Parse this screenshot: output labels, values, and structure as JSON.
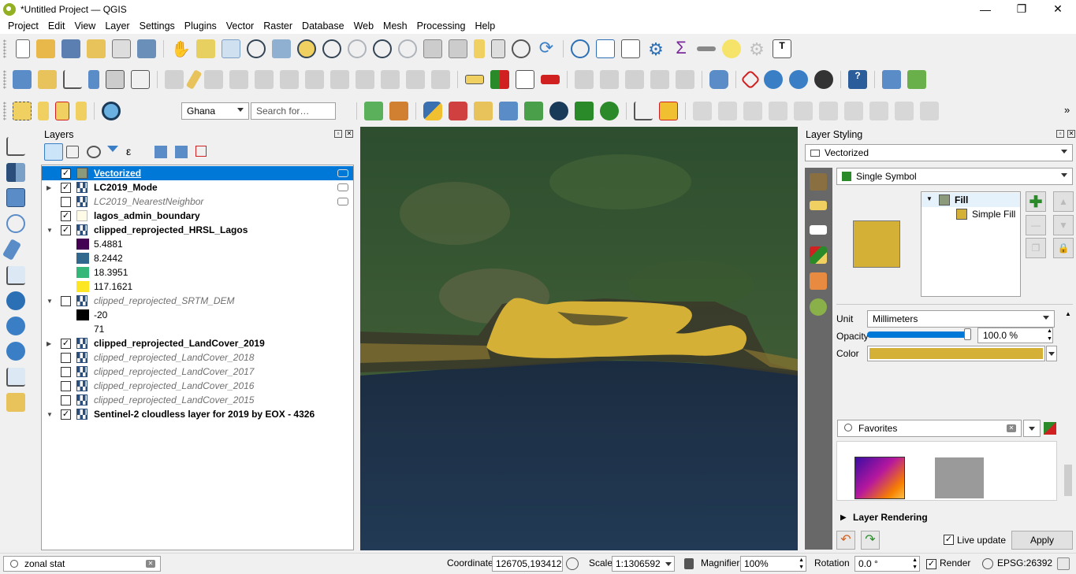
{
  "window": {
    "title": "*Untitled Project — QGIS",
    "controls": [
      "minimize-icon",
      "restore-icon",
      "close-icon"
    ]
  },
  "menu": [
    "Project",
    "Edit",
    "View",
    "Layer",
    "Settings",
    "Plugins",
    "Vector",
    "Raster",
    "Database",
    "Web",
    "Mesh",
    "Processing",
    "Help"
  ],
  "toolbar3": {
    "locator_value": "Ghana",
    "search_placeholder": "Search for…"
  },
  "layers_panel": {
    "title": "Layers",
    "items": [
      {
        "label": "Vectorized",
        "checked": true,
        "selected": true,
        "style": "bold-underline"
      },
      {
        "label": "LC2019_Mode",
        "checked": true,
        "style": "bold"
      },
      {
        "label": "LC2019_NearestNeighbor",
        "checked": false,
        "style": "italic"
      },
      {
        "label": "lagos_admin_boundary",
        "checked": true,
        "style": "bold"
      },
      {
        "label": "clipped_reprojected_HRSL_Lagos",
        "checked": true,
        "style": "bold"
      },
      {
        "label": "5.4881",
        "color": "#440154"
      },
      {
        "label": "8.2442",
        "color": "#31688e"
      },
      {
        "label": "18.3951",
        "color": "#35b779"
      },
      {
        "label": "117.1621",
        "color": "#fde725"
      },
      {
        "label": "clipped_reprojected_SRTM_DEM",
        "checked": false,
        "style": "italic"
      },
      {
        "label": "-20",
        "color": "#000000"
      },
      {
        "label": "71",
        "color": "#ffffff"
      },
      {
        "label": "clipped_reprojected_LandCover_2019",
        "checked": true,
        "style": "bold"
      },
      {
        "label": "clipped_reprojected_LandCover_2018",
        "checked": false,
        "style": "italic"
      },
      {
        "label": "clipped_reprojected_LandCover_2017",
        "checked": false,
        "style": "italic"
      },
      {
        "label": "clipped_reprojected_LandCover_2016",
        "checked": false,
        "style": "italic"
      },
      {
        "label": "clipped_reprojected_LandCover_2015",
        "checked": false,
        "style": "italic"
      },
      {
        "label": "Sentinel-2 cloudless layer for 2019 by EOX - 4326",
        "checked": true,
        "style": "bold"
      }
    ]
  },
  "styling_panel": {
    "title": "Layer Styling",
    "layer": "Vectorized",
    "renderer": "Single Symbol",
    "symbol_tree": {
      "root": "Fill",
      "child": "Simple Fill"
    },
    "unit_label": "Unit",
    "unit_value": "Millimeters",
    "opacity_label": "Opacity",
    "opacity_value": "100.0 %",
    "opacity_fraction": 1.0,
    "color_label": "Color",
    "fill_color": "#d4b037",
    "favorites_value": "Favorites",
    "layer_rendering": "Layer Rendering",
    "live_update": "Live update",
    "apply": "Apply"
  },
  "statusbar": {
    "search_value": "zonal stat",
    "coordinate_label": "Coordinate",
    "coordinate_value": "126705,193412",
    "scale_label": "Scale",
    "scale_value": "1:1306592",
    "magnifier_label": "Magnifier",
    "magnifier_value": "100%",
    "rotation_label": "Rotation",
    "rotation_value": "0.0 °",
    "render_label": "Render",
    "crs": "EPSG:26392"
  },
  "colors": {
    "selection": "#0078d7",
    "vector_fill": "#d4b037",
    "water": "#1d2f45",
    "land": "#2f5236"
  }
}
